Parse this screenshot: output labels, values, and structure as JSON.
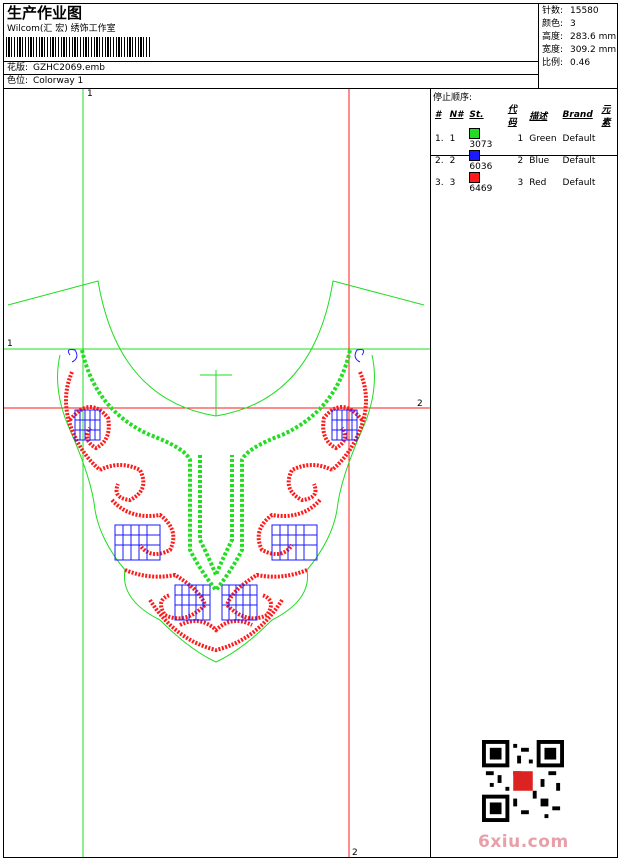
{
  "header": {
    "title": "生产作业图",
    "company": "Wilcom(汇 宏) 绣饰工作室",
    "design_label": "花版:",
    "design_value": "GZHC2069.emb",
    "colorway_label": "色位:",
    "colorway_value": "Colorway 1"
  },
  "stats": [
    {
      "label": "针数:",
      "value": "15580"
    },
    {
      "label": "颜色:",
      "value": "3"
    },
    {
      "label": "高度:",
      "value": "283.6 mm"
    },
    {
      "label": "宽度:",
      "value": "309.2 mm"
    },
    {
      "label": "比例:",
      "value": "0.46"
    }
  ],
  "stop_sequence": {
    "title": "停止顺序:",
    "columns": [
      "#",
      "N#",
      "St.",
      "代码",
      "描述",
      "Brand",
      "元素"
    ],
    "rows": [
      {
        "num": "1.",
        "n": "1",
        "code": "3073",
        "seq": "1",
        "desc": "Green",
        "brand": "Default",
        "color": "#22dd22"
      },
      {
        "num": "2.",
        "n": "2",
        "code": "6036",
        "seq": "2",
        "desc": "Blue",
        "brand": "Default",
        "color": "#1a1aff"
      },
      {
        "num": "3.",
        "n": "3",
        "code": "6469",
        "seq": "3",
        "desc": "Red",
        "brand": "Default",
        "color": "#ff1a1a"
      }
    ]
  },
  "guides": {
    "marker_green_top": "1",
    "marker_green_left": "1",
    "marker_red_right": "2",
    "marker_red_bottom": "2"
  },
  "colors": {
    "green": "#22dd22",
    "blue": "#1a1aff",
    "red": "#ff1a1a"
  },
  "watermark": "6xiu.com"
}
